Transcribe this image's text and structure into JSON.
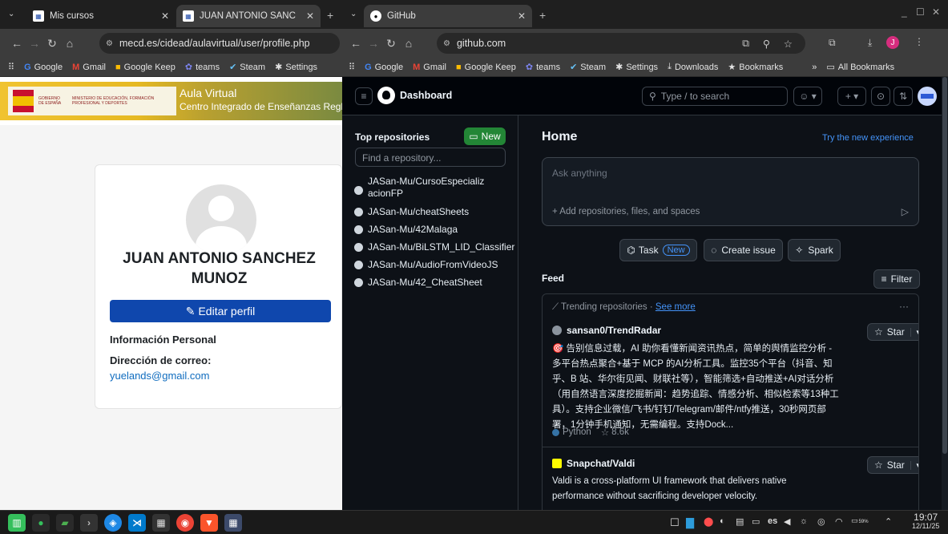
{
  "left_window": {
    "tabs": [
      {
        "title": "Mis cursos"
      },
      {
        "title": "JUAN ANTONIO SANCHEZ M"
      }
    ],
    "url": "mecd.es/cidead/aulavirtual/user/profile.php",
    "bookmarks": [
      "Google",
      "Gmail",
      "Google Keep",
      "teams",
      "Steam",
      "Settings"
    ],
    "banner": {
      "gov_text1": "GOBIERNO DE ESPAÑA",
      "gov_text2": "MINISTERIO DE EDUCACIÓN, FORMACIÓN PROFESIONAL Y DEPORTES",
      "title": "Aula Virtual",
      "subtitle": "Centro Integrado de Enseñanzas Regladas"
    },
    "profile": {
      "name": "JUAN ANTONIO SANCHEZ MUNOZ",
      "edit_label": "Editar perfil",
      "section_title": "Información Personal",
      "email_label": "Dirección de correo:",
      "email": "yuelands@gmail.com"
    }
  },
  "right_window": {
    "tab_title": "GitHub",
    "url": "github.com",
    "bookmarks": [
      "Google",
      "Gmail",
      "Google Keep",
      "teams",
      "Steam",
      "Settings",
      "Downloads",
      "Bookmarks"
    ],
    "all_bookmarks": "All Bookmarks",
    "header": {
      "title": "Dashboard",
      "search_placeholder": "Type / to search",
      "avatar_initial": "J"
    },
    "sidebar": {
      "title": "Top repositories",
      "new_label": "New",
      "find_placeholder": "Find a repository...",
      "repos": [
        "JASan-Mu/CursoEspecializacionFP",
        "JASan-Mu/cheatSheets",
        "JASan-Mu/42Malaga",
        "JASan-Mu/BiLSTM_LID_Classifier",
        "JASan-Mu/AudioFromVideoJS",
        "JASan-Mu/42_CheatSheet"
      ]
    },
    "home": {
      "title": "Home",
      "try_new": "Try the new experience",
      "ask_placeholder": "Ask anything",
      "add_label": "Add repositories, files, and spaces",
      "actions": {
        "task": "Task",
        "task_badge": "New",
        "issue": "Create issue",
        "spark": "Spark"
      },
      "feed_title": "Feed",
      "filter_label": "Filter",
      "trending_label": "Trending repositories",
      "see_more": "See more",
      "star_label": "Star",
      "trending": [
        {
          "name": "sansan0/TrendRadar",
          "description": "🎯 告别信息过载，AI 助你看懂新闻资讯热点，简单的舆情监控分析 - 多平台热点聚合+基于 MCP 的AI分析工具。监控35个平台（抖音、知乎、B 站、华尔街见闻、财联社等），智能筛选+自动推送+AI对话分析（用自然语言深度挖掘新闻：趋势追踪、情感分析、相似检索等13种工具）。支持企业微信/飞书/钉钉/Telegram/邮件/ntfy推送，30秒网页部署，1分钟手机通知，无需编程。支持Dock...",
          "language": "Python",
          "stars": "8.6k"
        },
        {
          "name": "Snapchat/Valdi",
          "description": "Valdi is a cross-platform UI framework that delivers native performance without sacrificing developer velocity."
        }
      ]
    }
  },
  "taskbar": {
    "language": "es",
    "time": "19:07",
    "date": "12/11/25",
    "battery": "59%"
  },
  "colors": {
    "github_bg": "#0d1117",
    "moodle_button": "#0f47ad",
    "github_link": "#4493f8",
    "github_green": "#238636"
  }
}
